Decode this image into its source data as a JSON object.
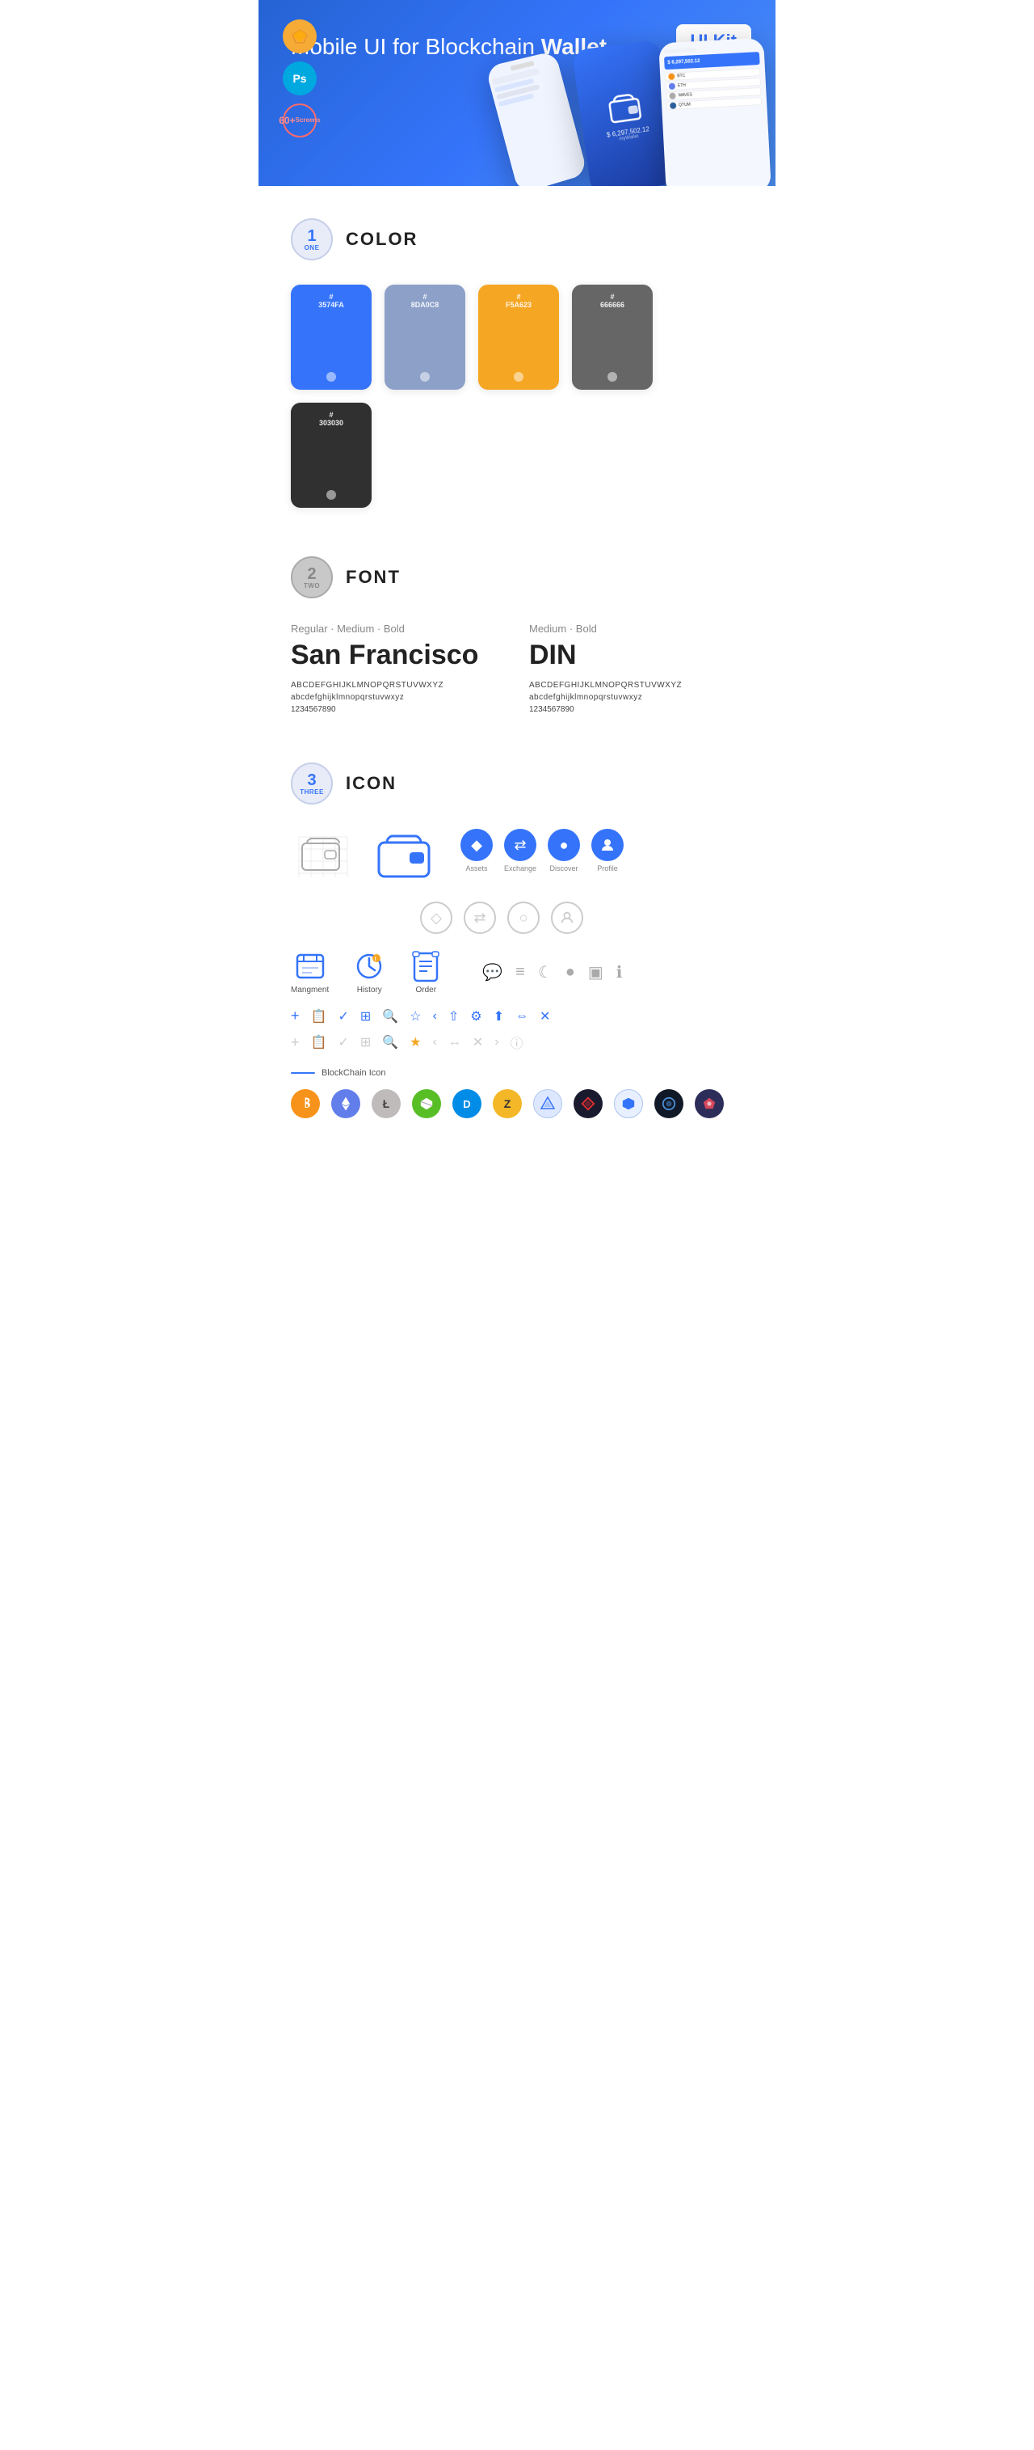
{
  "hero": {
    "title_normal": "Mobile UI for Blockchain ",
    "title_bold": "Wallet",
    "badge": "UI Kit",
    "badges": [
      {
        "label": "Sketch",
        "type": "sketch"
      },
      {
        "label": "Ps",
        "type": "ps"
      },
      {
        "label": "60+\nScreens",
        "type": "screens"
      }
    ]
  },
  "sections": {
    "color": {
      "number": "1",
      "number_label": "ONE",
      "title": "COLOR",
      "swatches": [
        {
          "hex": "#3574FA",
          "label": "#\n3574FA",
          "bg": "#3574FA"
        },
        {
          "hex": "#8DA0C8",
          "label": "#\n8DA0C8",
          "bg": "#8DA0C8"
        },
        {
          "hex": "#F5A623",
          "label": "#\nF5A623",
          "bg": "#F5A623"
        },
        {
          "hex": "#666666",
          "label": "#\n666666",
          "bg": "#666666"
        },
        {
          "hex": "#303030",
          "label": "#\n303030",
          "bg": "#303030"
        }
      ]
    },
    "font": {
      "number": "2",
      "number_label": "TWO",
      "title": "FONT",
      "fonts": [
        {
          "weights": "Regular · Medium · Bold",
          "name": "San Francisco",
          "uppercase": "ABCDEFGHIJKLMNOPQRSTUVWXYZ",
          "lowercase": "abcdefghijklmnopqrstuvwxyz",
          "numbers": "1234567890"
        },
        {
          "weights": "Medium · Bold",
          "name": "DIN",
          "uppercase": "ABCDEFGHIJKLMNOPQRSTUVWXYZ",
          "lowercase": "abcdefghijklmnopqrstuvwxyz",
          "numbers": "1234567890"
        }
      ]
    },
    "icon": {
      "number": "3",
      "number_label": "THREE",
      "title": "ICON",
      "nav_icons": [
        {
          "label": "Assets"
        },
        {
          "label": "Exchange"
        },
        {
          "label": "Discover"
        },
        {
          "label": "Profile"
        }
      ],
      "app_icons": [
        {
          "label": "Mangment"
        },
        {
          "label": "History"
        },
        {
          "label": "Order"
        }
      ],
      "blockchain_divider": "BlockChain Icon",
      "blockchain_icons": [
        {
          "label": "BTC",
          "type": "btc"
        },
        {
          "label": "ETH",
          "type": "eth"
        },
        {
          "label": "LTC",
          "type": "ltc"
        },
        {
          "label": "NEO",
          "type": "neo"
        },
        {
          "label": "DASH",
          "type": "dash"
        },
        {
          "label": "ZEC",
          "type": "zcash"
        },
        {
          "label": "IOTA",
          "type": "iota"
        },
        {
          "label": "ARK",
          "type": "ark"
        },
        {
          "label": "KNC",
          "type": "kyber"
        },
        {
          "label": "BNT",
          "type": "bancor"
        },
        {
          "label": "MANA",
          "type": "mana"
        }
      ]
    }
  }
}
